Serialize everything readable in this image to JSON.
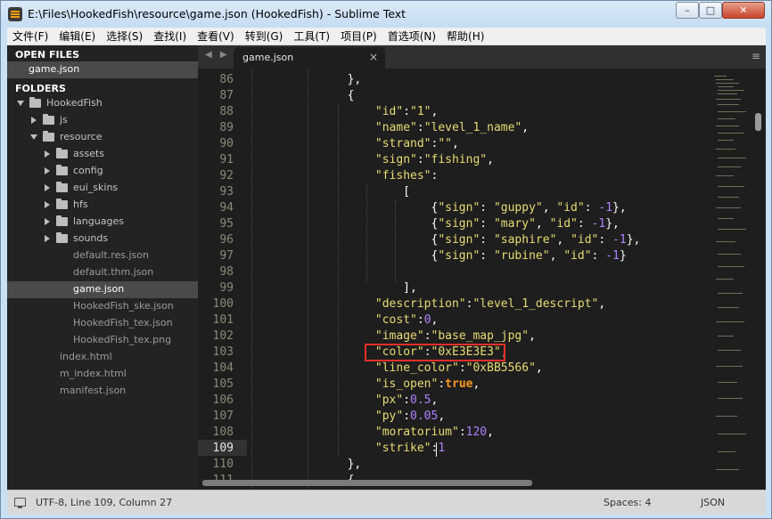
{
  "window": {
    "title": "E:\\Files\\HookedFish\\resource\\game.json (HookedFish) - Sublime Text",
    "minimize": "–",
    "maximize": "□",
    "close": "✕"
  },
  "menu": [
    "文件(F)",
    "编辑(E)",
    "选择(S)",
    "查找(I)",
    "查看(V)",
    "转到(G)",
    "工具(T)",
    "项目(P)",
    "首选项(N)",
    "帮助(H)"
  ],
  "sidebar": {
    "open_files_header": "OPEN FILES",
    "open_files": [
      "game.json"
    ],
    "folders_header": "FOLDERS",
    "tree": [
      {
        "label": "HookedFish",
        "type": "folder",
        "open": true
      },
      {
        "label": "js",
        "type": "folder",
        "open": false
      },
      {
        "label": "resource",
        "type": "folder",
        "open": true
      },
      {
        "label": "assets",
        "type": "folder",
        "open": false
      },
      {
        "label": "config",
        "type": "folder",
        "open": false
      },
      {
        "label": "eui_skins",
        "type": "folder",
        "open": false
      },
      {
        "label": "hfs",
        "type": "folder",
        "open": false
      },
      {
        "label": "languages",
        "type": "folder",
        "open": false
      },
      {
        "label": "sounds",
        "type": "folder",
        "open": false
      },
      {
        "label": "default.res.json",
        "type": "file"
      },
      {
        "label": "default.thm.json",
        "type": "file"
      },
      {
        "label": "game.json",
        "type": "file",
        "selected": true
      },
      {
        "label": "HookedFish_ske.json",
        "type": "file"
      },
      {
        "label": "HookedFish_tex.json",
        "type": "file"
      },
      {
        "label": "HookedFish_tex.png",
        "type": "file"
      },
      {
        "label": "index.html",
        "type": "file"
      },
      {
        "label": "m_index.html",
        "type": "file"
      },
      {
        "label": "manifest.json",
        "type": "file"
      }
    ]
  },
  "tabs": {
    "nav": "◀ ▶",
    "active_label": "game.json",
    "close": "×",
    "menu": "≡"
  },
  "editor": {
    "current_line": 109,
    "line_numbers": [
      "86",
      "87",
      "88",
      "89",
      "90",
      "91",
      "92",
      "93",
      "94",
      "95",
      "96",
      "97",
      "98",
      "99",
      "100",
      "101",
      "102",
      "103",
      "104",
      "105",
      "106",
      "107",
      "108",
      "109",
      "110",
      "111"
    ],
    "highlight_line": "103",
    "colors": {
      "background": "#1e1e1e",
      "string": "#e6db74",
      "number": "#ae81ff",
      "boolean": "#fd971f",
      "highlight_box": "#e8302b"
    }
  },
  "status": {
    "left": "UTF-8, Line 109, Column 27",
    "spaces": "Spaces: 4",
    "syntax": "JSON"
  }
}
